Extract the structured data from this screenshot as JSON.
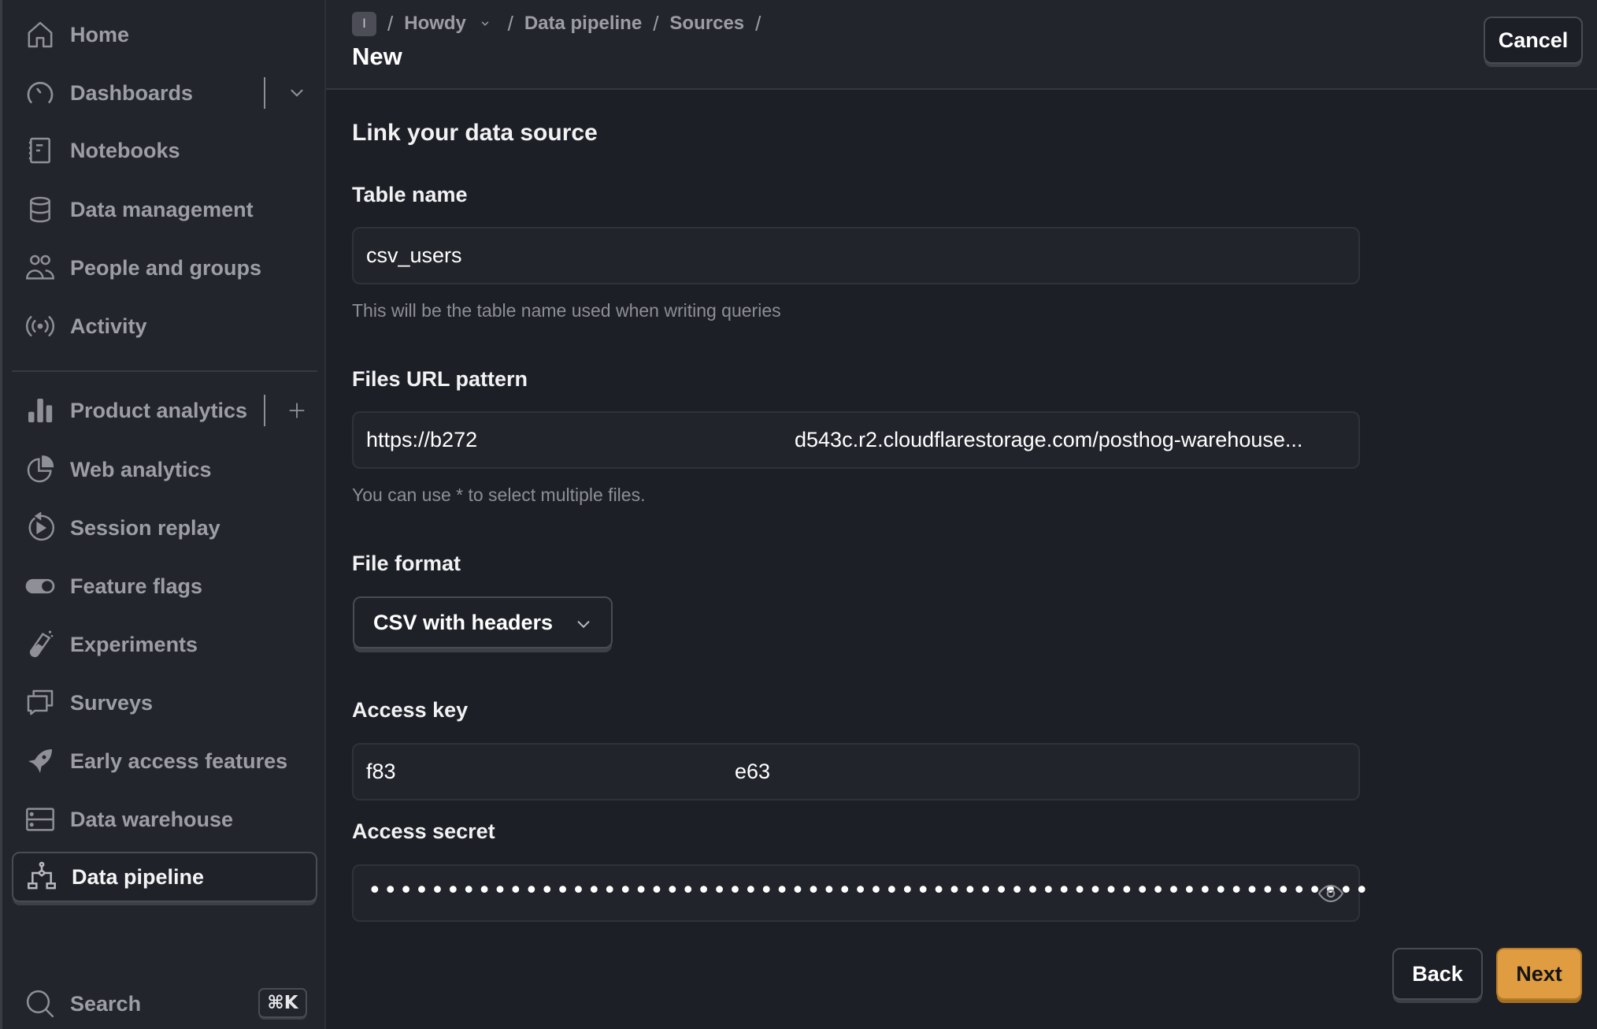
{
  "sidebar": {
    "items": [
      {
        "label": "Home",
        "icon": "home-icon"
      },
      {
        "label": "Dashboards",
        "icon": "dashboard-gauge-icon"
      },
      {
        "label": "Notebooks",
        "icon": "notebook-icon"
      },
      {
        "label": "Data management",
        "icon": "database-icon"
      },
      {
        "label": "People and groups",
        "icon": "people-icon"
      },
      {
        "label": "Activity",
        "icon": "activity-broadcast-icon"
      },
      {
        "label": "Product analytics",
        "icon": "bar-chart-icon"
      },
      {
        "label": "Web analytics",
        "icon": "pie-chart-icon"
      },
      {
        "label": "Session replay",
        "icon": "replay-icon"
      },
      {
        "label": "Feature flags",
        "icon": "toggle-icon"
      },
      {
        "label": "Experiments",
        "icon": "flask-icon"
      },
      {
        "label": "Surveys",
        "icon": "chat-bubbles-icon"
      },
      {
        "label": "Early access features",
        "icon": "rocket-icon"
      },
      {
        "label": "Data warehouse",
        "icon": "server-icon"
      },
      {
        "label": "Data pipeline",
        "icon": "pipeline-icon",
        "active": true
      }
    ],
    "search_label": "Search",
    "search_shortcut": "⌘K"
  },
  "header": {
    "project_badge": "I",
    "breadcrumbs": [
      "Howdy",
      "Data pipeline",
      "Sources"
    ],
    "title": "New",
    "cancel_label": "Cancel"
  },
  "form": {
    "title": "Link your data source",
    "table_name": {
      "label": "Table name",
      "value": "csv_users",
      "hint": "This will be the table name used when writing queries"
    },
    "url_pattern": {
      "label": "Files URL pattern",
      "value_start": "https://b272",
      "value_end": "d543c.r2.cloudflarestorage.com/posthog-warehouse...",
      "hint": "You can use * to select multiple files."
    },
    "file_format": {
      "label": "File format",
      "selected": "CSV with headers"
    },
    "access_key": {
      "label": "Access key",
      "value_start": "f83",
      "value_end": "e63"
    },
    "access_secret": {
      "label": "Access secret",
      "masked_value": "••••••••••••••••••••••••••••••••••••••••••••••••••••••••••••••••"
    },
    "back_label": "Back",
    "next_label": "Next"
  },
  "colors": {
    "accent": "#e09c40",
    "sidebar_bg": "#23252d",
    "main_bg": "#1d1f27"
  }
}
